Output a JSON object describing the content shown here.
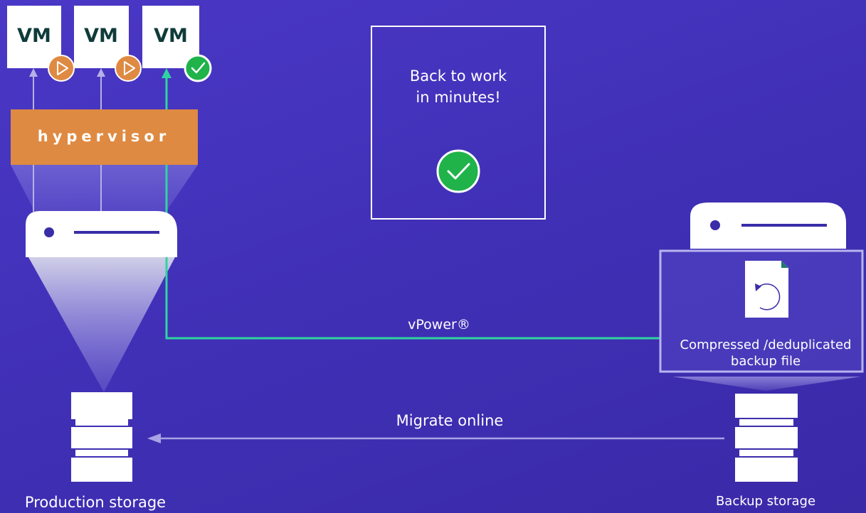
{
  "vms": [
    {
      "label": "VM",
      "status": "playing"
    },
    {
      "label": "VM",
      "status": "playing"
    },
    {
      "label": "VM",
      "status": "ok"
    }
  ],
  "hypervisor": {
    "label": "hypervisor"
  },
  "callout": {
    "line1": "Back to work",
    "line2": "in minutes!"
  },
  "vpower": {
    "label": "vPower®"
  },
  "backup_file": {
    "line1": "Compressed /deduplicated",
    "line2": "backup file"
  },
  "migrate": {
    "label": "Migrate online"
  },
  "production_storage": {
    "label": "Production storage"
  },
  "backup_storage": {
    "label": "Backup storage"
  },
  "colors": {
    "background": "#4033b8",
    "accent_teal": "#2fd5a0",
    "hypervisor_orange": "#df8a42",
    "ok_green": "#1fb34a",
    "vm_text": "#0f3b3a"
  }
}
